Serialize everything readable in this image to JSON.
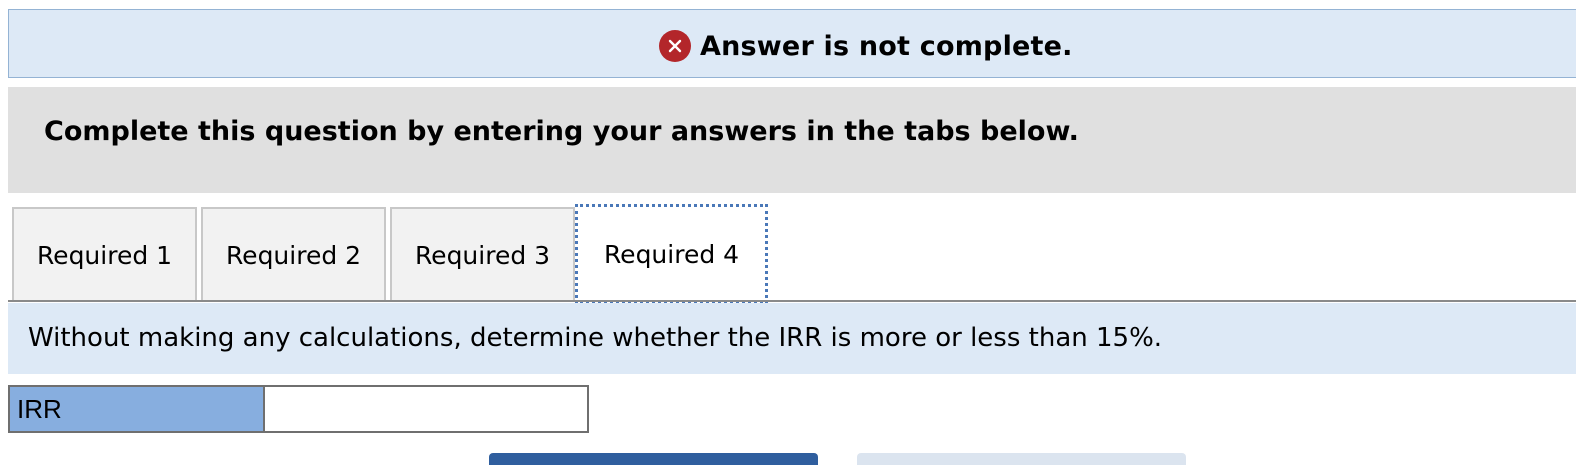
{
  "alert": {
    "icon": "error-x-icon",
    "icon_color": "#b3262a",
    "text": "Answer is not complete."
  },
  "instructions": {
    "text": "Complete this question by entering your answers in the tabs below."
  },
  "tabs": [
    {
      "label": "Required 1",
      "active": false
    },
    {
      "label": "Required 2",
      "active": false
    },
    {
      "label": "Required 3",
      "active": false
    },
    {
      "label": "Required 4",
      "active": true
    }
  ],
  "question": {
    "text": "Without making any calculations, determine whether the IRR is more or less than 15%."
  },
  "answer_table": {
    "label": "IRR",
    "value": "",
    "label_bg": "#87aedf"
  },
  "colors": {
    "banner_bg": "#dde9f6",
    "instructions_bg": "#e0e0e0",
    "active_tab_border": "#4a78b8",
    "primary_button": "#2f5e9e",
    "secondary_button": "#dbe4ef"
  }
}
